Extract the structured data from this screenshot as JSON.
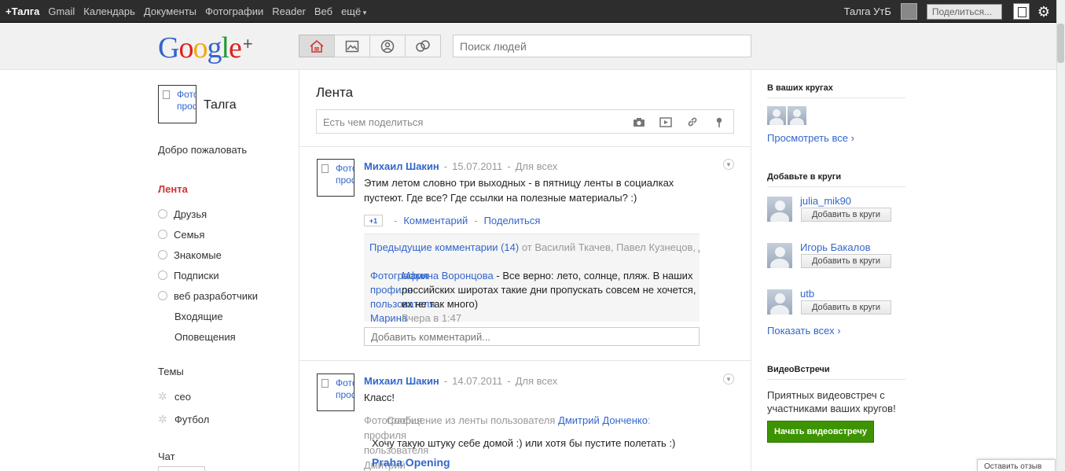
{
  "topbar": {
    "nav": [
      {
        "label": "+Талга",
        "active": true
      },
      {
        "label": "Gmail"
      },
      {
        "label": "Календарь"
      },
      {
        "label": "Документы"
      },
      {
        "label": "Фотографии"
      },
      {
        "label": "Reader"
      },
      {
        "label": "Веб"
      },
      {
        "label": "ещё"
      }
    ],
    "username": "Талга УтБ",
    "share_button": "Поделиться..."
  },
  "header": {
    "logo": {
      "G": "G",
      "o1": "o",
      "o2": "o",
      "g": "g",
      "l": "l",
      "e": "e",
      "plus": "+"
    },
    "search_placeholder": "Поиск людей"
  },
  "sidebar": {
    "profile_photo_text": "Фото профиля",
    "profile_name": "Талга",
    "welcome": "Добро пожаловать",
    "feed": "Лента",
    "circles": [
      "Друзья",
      "Семья",
      "Знакомые",
      "Подписки",
      "веб разработчики"
    ],
    "extra": [
      "Входящие",
      "Оповещения"
    ],
    "topics_heading": "Темы",
    "topics": [
      "ceo",
      "Футбол"
    ],
    "chat_heading": "Чат"
  },
  "stream": {
    "title": "Лента",
    "share_placeholder": "Есть чем поделиться",
    "posts": [
      {
        "avatar_text": "Фото профиля",
        "author": "Михаил Шакин",
        "date": "15.07.2011",
        "visibility": "Для всех",
        "text": "Этим летом словно три выходных - в пятницу ленты в социалках пустеют. Где все? Где ссылки на полезные материалы? :)",
        "plusone": "+1",
        "comment_label": "Комментарий",
        "share_label": "Поделиться",
        "prev_comments_link": "Предыдущие комментарии (14)",
        "prev_comments_from": "от Василий Ткачев, Павел Кузнецов, Д",
        "comment": {
          "photo_text": "Фотография профиля пользователя Марина Воронцова",
          "author": "Марина Воронцова",
          "text": "Все верно: лето, солнце, пляж. В наших российских широтах такие дни пропускать совсем не хочется, их не так много)",
          "time": "Вчера в 1:47"
        },
        "add_comment_placeholder": "Добавить комментарий..."
      },
      {
        "avatar_text": "Фото профиля",
        "author": "Михаил Шакин",
        "date": "14.07.2011",
        "visibility": "Для всех",
        "text": "Класс!",
        "reshare_photo_text": "Фотография профиля пользователя Дмитрий",
        "reshare_prefix": "Сообщение из ленты пользователя",
        "reshare_user": "Дмитрий Донченко",
        "reshare_text": "Хочу такую штуку себе домой :) или хотя бы пустите полетать :)",
        "reshare_link": "Praha Opening"
      }
    ]
  },
  "right": {
    "in_circles_heading": "В ваших кругах",
    "view_all": "Просмотреть все ›",
    "add_heading": "Добавьте в круги",
    "suggestions": [
      {
        "name": "julia_mik90",
        "button": "Добавить в круги"
      },
      {
        "name": "Игорь Бакалов",
        "button": "Добавить в круги"
      },
      {
        "name": "utb",
        "button": "Добавить в круги"
      }
    ],
    "show_all": "Показать всех ›",
    "video_heading": "ВидеоВстречи",
    "video_text": "Приятных видеовстреч с участниками ваших кругов!",
    "video_button": "Начать видеовстречу",
    "corner_text": "Оставить отзыв"
  }
}
